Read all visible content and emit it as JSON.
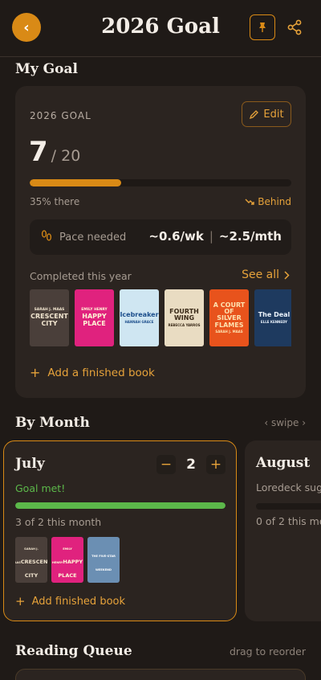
{
  "header": {
    "title": "2026 Goal",
    "back_glyph": "‹",
    "icons": {
      "back": "chevron-left-icon",
      "pin": "pin-icon",
      "share": "share-icon"
    }
  },
  "colors": {
    "accent": "#d98a16",
    "success": "#5cb84a",
    "background": "#1f1a17",
    "card": "#2b2420"
  },
  "my_goal": {
    "section_title": "My Goal",
    "label": "2026 GOAL",
    "edit_label": "Edit",
    "current": "7",
    "total": "/ 20",
    "progress": 0.35,
    "percent_text": "35% there",
    "status": "Behind",
    "pace_label": "Pace needed",
    "pace_week": "~0.6/wk",
    "pace_month": "~2.5/mth",
    "completed_label": "Completed this year",
    "see_all_label": "See all",
    "add_finished_label": "Add a finished book",
    "covers": [
      {
        "top": "SARAH J. MAAS",
        "title": "CRESCENT CITY",
        "bg": "#4a3f3a",
        "fg": "#f2e6d0"
      },
      {
        "top": "EMILY HENRY",
        "title": "HAPPY PLACE",
        "bg": "#e0227e",
        "fg": "#fff7d6"
      },
      {
        "top": "",
        "title": "Icebreaker",
        "bottom": "HANNAH GRACE",
        "bg": "#cfe6f2",
        "fg": "#1d4f8c"
      },
      {
        "top": "",
        "title": "FOURTH WING",
        "bottom": "REBECCA YARROS",
        "bg": "#e9dcc2",
        "fg": "#3a2a18"
      },
      {
        "top": "",
        "title": "A COURT OF SILVER FLAMES",
        "bottom": "SARAH J. MAAS",
        "bg": "#e8531c",
        "fg": "#fde2b0"
      },
      {
        "top": "",
        "title": "The Deal",
        "bottom": "ELLE KENNEDY",
        "bg": "#1e3a5f",
        "fg": "#eaf2fb"
      }
    ]
  },
  "by_month": {
    "section_title": "By Month",
    "swipe_hint": "‹ swipe ›",
    "months": [
      {
        "name": "July",
        "goal_value": "2",
        "status": "Goal met!",
        "progress": 1.0,
        "summary": "3 of 2 this month",
        "add_label": "Add finished book",
        "covers": [
          {
            "top": "SARAH J. MAAS",
            "title": "CRESCENT CITY",
            "bg": "#4a3f3a",
            "fg": "#f2e6d0"
          },
          {
            "top": "EMILY HENRY",
            "title": "HAPPY PLACE",
            "bg": "#e0227e",
            "fg": "#fff7d6"
          },
          {
            "top": "THE FIVE-STAR WEEKEND",
            "title": "",
            "bg": "#6b8fb3",
            "fg": "#fff"
          }
        ]
      },
      {
        "name": "August",
        "status": "Loredeck sugg",
        "progress": 0,
        "summary": "0 of 2 this mo"
      }
    ]
  },
  "reading_queue": {
    "section_title": "Reading Queue",
    "drag_hint": "drag to reorder"
  }
}
